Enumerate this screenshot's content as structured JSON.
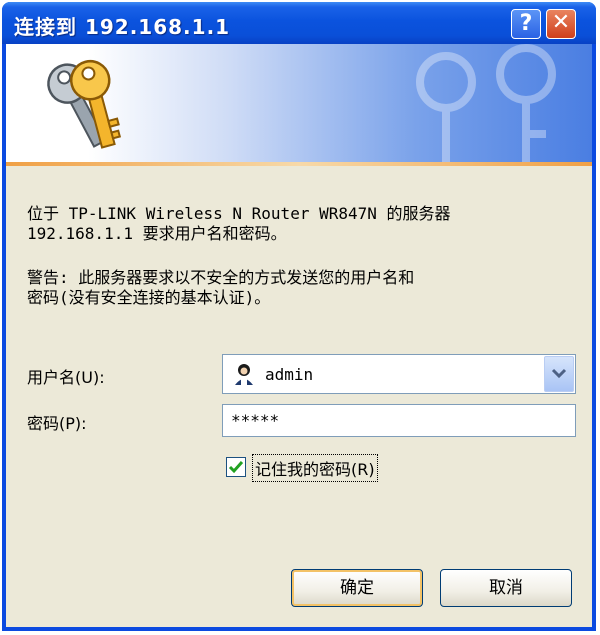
{
  "window": {
    "title": "连接到 192.168.1.1"
  },
  "titlebar": {
    "help_glyph": "?",
    "close_glyph": "✕"
  },
  "banner": {
    "icon": "keys-icon"
  },
  "message": {
    "line1": "位于 TP-LINK Wireless N Router WR847N 的服务器",
    "line2": "192.168.1.1 要求用户名和密码。",
    "warn1": "警告: 此服务器要求以不安全的方式发送您的用户名和",
    "warn2": "密码(没有安全连接的基本认证)。"
  },
  "form": {
    "username_label": "用户名(U):",
    "username_value": "admin",
    "password_label": "密码(P):",
    "password_value": "*****",
    "remember_label": "记住我的密码(R)",
    "remember_checked": true
  },
  "buttons": {
    "ok": "确定",
    "cancel": "取消"
  },
  "colors": {
    "title_blue": "#0b53de",
    "dialog_bg": "#ece9d8",
    "close_red": "#cf3f1c"
  }
}
